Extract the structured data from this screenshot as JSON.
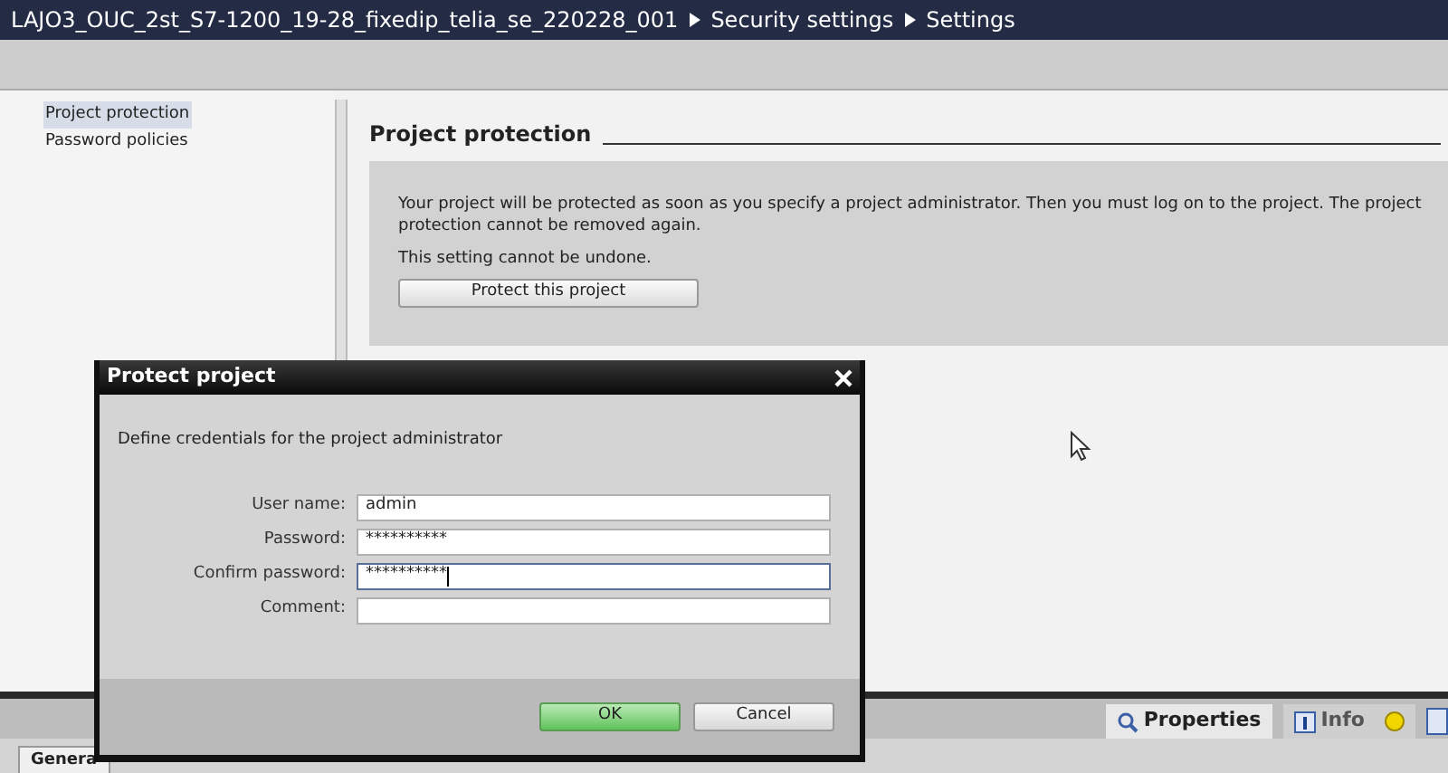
{
  "breadcrumb": [
    "LAJO3_OUC_2st_S7-1200_19-28_fixedip_telia_se_220228_001",
    "Security settings",
    "Settings"
  ],
  "sidebar": {
    "items": [
      {
        "label": "Project protection",
        "selected": true
      },
      {
        "label": "Password policies",
        "selected": false
      }
    ]
  },
  "section": {
    "title": "Project protection",
    "text": "Your project will be protected as soon as you specify a project administrator. Then you must log on to the project. The project protection cannot be removed again.",
    "note": "This setting cannot be undone.",
    "button": "Protect this project"
  },
  "bottom_tabs": [
    {
      "label": "Properties",
      "selected": true
    },
    {
      "label": "Info",
      "selected": false
    }
  ],
  "lower_tab": "Genera",
  "dialog": {
    "title": "Protect project",
    "intro": "Define credentials for the project administrator",
    "fields": [
      {
        "label": "User name:",
        "value": "admin",
        "focused": false
      },
      {
        "label": "Password:",
        "value": "**********",
        "focused": false
      },
      {
        "label": "Confirm password:",
        "value": "**********",
        "focused": true
      },
      {
        "label": "Comment:",
        "focused": false
      }
    ],
    "buttons": [
      {
        "label": "OK",
        "kind": "primary"
      },
      {
        "label": "Cancel",
        "kind": "secondary"
      }
    ]
  }
}
